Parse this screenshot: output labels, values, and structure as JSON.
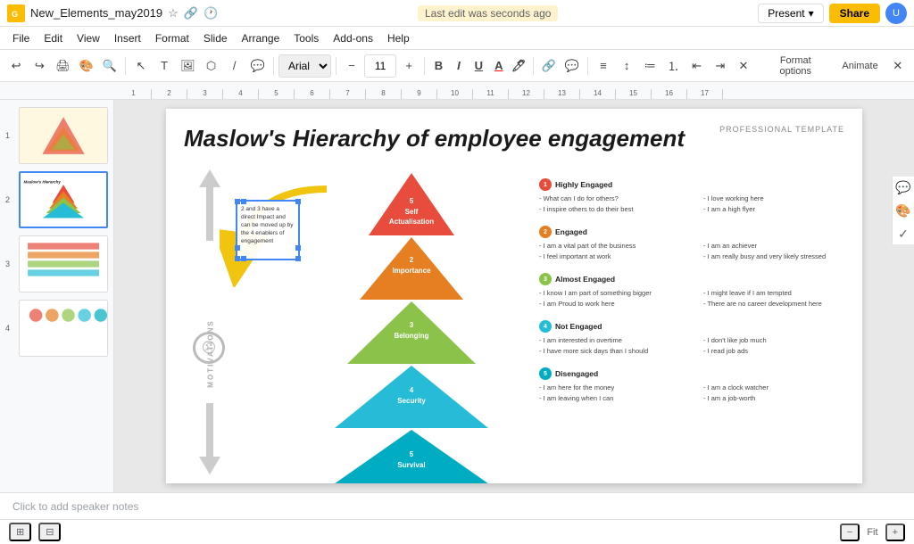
{
  "topbar": {
    "filename": "New_Elements_may2019",
    "save_message": "Last edit was seconds ago",
    "present_label": "Present",
    "share_label": "Share",
    "avatar_initials": "U"
  },
  "menubar": {
    "items": [
      "File",
      "Edit",
      "View",
      "Insert",
      "Format",
      "Slide",
      "Arrange",
      "Tools",
      "Add-ons",
      "Help"
    ]
  },
  "toolbar": {
    "font_name": "Arial",
    "font_size": "11",
    "format_options_label": "Format options",
    "animate_label": "Animate"
  },
  "slide": {
    "title": "Maslow's Hierarchy of employee engagement",
    "subtitle": "PROFESSIONAL TEMPLATE",
    "selection_text": "2 and 3 have a direct Impact and can be moved up by the 4 enablers of engagement"
  },
  "pyramid": {
    "levels": [
      {
        "num": "5",
        "label": "Self\nActualisation",
        "color": "#e74c3c"
      },
      {
        "num": "2",
        "label": "Importance",
        "color": "#e67e22"
      },
      {
        "num": "3",
        "label": "Belonging",
        "color": "#8bc34a"
      },
      {
        "num": "4",
        "label": "Security",
        "color": "#26bcd7"
      },
      {
        "num": "5",
        "label": "Survival",
        "color": "#00acc1"
      }
    ]
  },
  "engagement": [
    {
      "num": "1",
      "color": "#e74c3c",
      "title": "Highly Engaged",
      "left": [
        "- What can I do for others?",
        "- I inspire others to do their best"
      ],
      "right": [
        "- I love working here",
        "- I am a high flyer"
      ]
    },
    {
      "num": "2",
      "color": "#e67e22",
      "title": "Engaged",
      "left": [
        "- I am a vital part of the business",
        "- I feel important at work"
      ],
      "right": [
        "- I am an achiever",
        "- I am really busy and very likely stressed"
      ]
    },
    {
      "num": "3",
      "color": "#8bc34a",
      "title": "Almost Engaged",
      "left": [
        "- I know I am part of something bigger",
        "- I am Proud to work here"
      ],
      "right": [
        "- I might leave if I am tempted",
        "- There are no career development here"
      ]
    },
    {
      "num": "4",
      "color": "#26bcd7",
      "title": "Not Engaged",
      "left": [
        "- I am interested in overtime",
        "- I have more sick days than I should"
      ],
      "right": [
        "- I don't like job much",
        "- I read job ads"
      ]
    },
    {
      "num": "5",
      "color": "#00acc1",
      "title": "Disengaged",
      "left": [
        "- I am here for the money",
        "- I am leaving when I can"
      ],
      "right": [
        "- I am a clock watcher",
        "- I am a job-worth"
      ]
    }
  ],
  "motivations_label": "MOTIVATIONS",
  "speaker_notes_placeholder": "Click to add speaker notes",
  "bottom": {
    "grid_icon": "⊞",
    "filmstrip_icon": "⊟",
    "page_indicator": ""
  },
  "slides_panel": [
    {
      "num": "1",
      "active": false
    },
    {
      "num": "2",
      "active": true
    },
    {
      "num": "3",
      "active": false
    },
    {
      "num": "4",
      "active": false
    }
  ]
}
